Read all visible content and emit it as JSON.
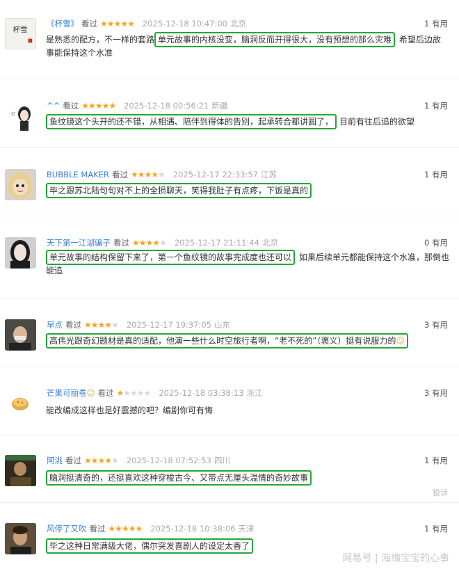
{
  "reviews": [
    {
      "user": "《杯雪》",
      "watched": "看过",
      "rating": 5,
      "time": "2025-12-18 10:47:00",
      "location": "北京",
      "useful": "1 有用",
      "pre": "是熟悉的配方，不一样的套路",
      "highlight": "单元故事的内核没变，脑洞反而开得很大，没有预想的那么灾难",
      "post": "希望后边故事能保持这个水准",
      "avatar_text": "杯雪"
    },
    {
      "user": "^^",
      "watched": "看过",
      "rating": 5,
      "time": "2025-12-18 00:56:21",
      "location": "新疆",
      "useful": "1 有用",
      "pre": "",
      "highlight": "鱼纹镜这个头开的还不错，从相遇、陪伴到得体的告别，起承转合都讲圆了，",
      "post": "目前有往后追的欲望"
    },
    {
      "user": "BUBBLE MAKER",
      "watched": "看过",
      "rating": 4,
      "time": "2025-12-17 22:33:57",
      "location": "江苏",
      "useful": "1 有用",
      "pre": "",
      "highlight": "毕之跟苏北陆句句对不上的全损聊天，笑得我肚子有点疼，下饭是真的",
      "post": ""
    },
    {
      "user": "天下第一江湖骗子",
      "watched": "看过",
      "rating": 4,
      "time": "2025-12-17 21:11:44",
      "location": "北京",
      "useful": "0 有用",
      "pre": "",
      "highlight": "单元故事的结构保留下来了，第一个鱼纹镜的故事完成度也还可以",
      "post": "如果后续单元都能保持这个水准，那倒也能追"
    },
    {
      "user": "早点",
      "watched": "看过",
      "rating": 4,
      "time": "2025-12-17 19:37:05",
      "location": "山东",
      "useful": "3 有用",
      "pre": "",
      "highlight": "高伟光跟奇幻题材是真的适配，他演一些什么时空旅行者啊，“老不死的”（褒义）挺有说服力的",
      "post": ""
    },
    {
      "user": "芒果可丽卷",
      "watched": "看过",
      "rating": 1,
      "time": "2025-12-18 03:38:13",
      "location": "浙江",
      "useful": "3 有用",
      "pre": "能改编成这样也是好震撼的吧？编剧你可有悔",
      "highlight": "",
      "post": ""
    },
    {
      "user": "阿洮",
      "watched": "看过",
      "rating": 4,
      "time": "2025-12-18 07:52:53",
      "location": "四川",
      "useful": "1 有用",
      "pre": "",
      "highlight": "脑洞挺清奇的，还挺喜欢这种穿梭古今、又带点无厘头温情的奇妙故事",
      "post": ""
    },
    {
      "user": "风停了又吹",
      "watched": "看过",
      "rating": 5,
      "time": "2025-12-18 10:38:06",
      "location": "天津",
      "useful": "1 有用",
      "pre": "",
      "highlight": "毕之这种日常满级大佬，偶尔突发喜剧人的设定太香了",
      "post": ""
    }
  ],
  "report_label": "投诉",
  "watermark": "网易号 | 海绵宝宝的心事",
  "colors": {
    "highlight_border": "#22a83a",
    "username": "#3a7fd5",
    "star": "#f5a623"
  }
}
